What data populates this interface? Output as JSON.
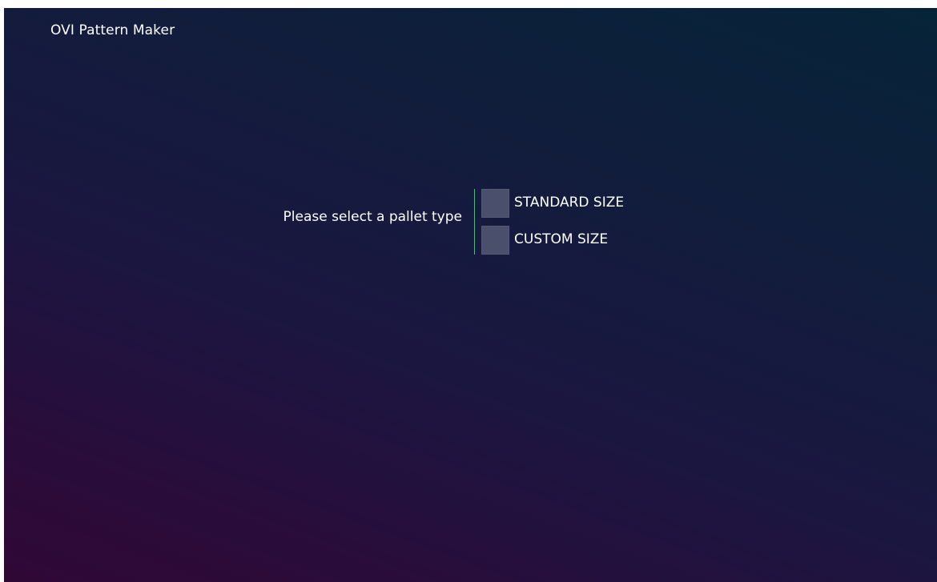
{
  "app": {
    "title": "OVI Pattern Maker"
  },
  "pallet_selection": {
    "prompt": "Please select a pallet type",
    "options": [
      {
        "label": "STANDARD SIZE",
        "checked": false
      },
      {
        "label": "CUSTOM SIZE",
        "checked": false
      }
    ]
  },
  "colors": {
    "accent_divider": "#2fd15b",
    "checkbox_fill": "#4a4f6b"
  }
}
